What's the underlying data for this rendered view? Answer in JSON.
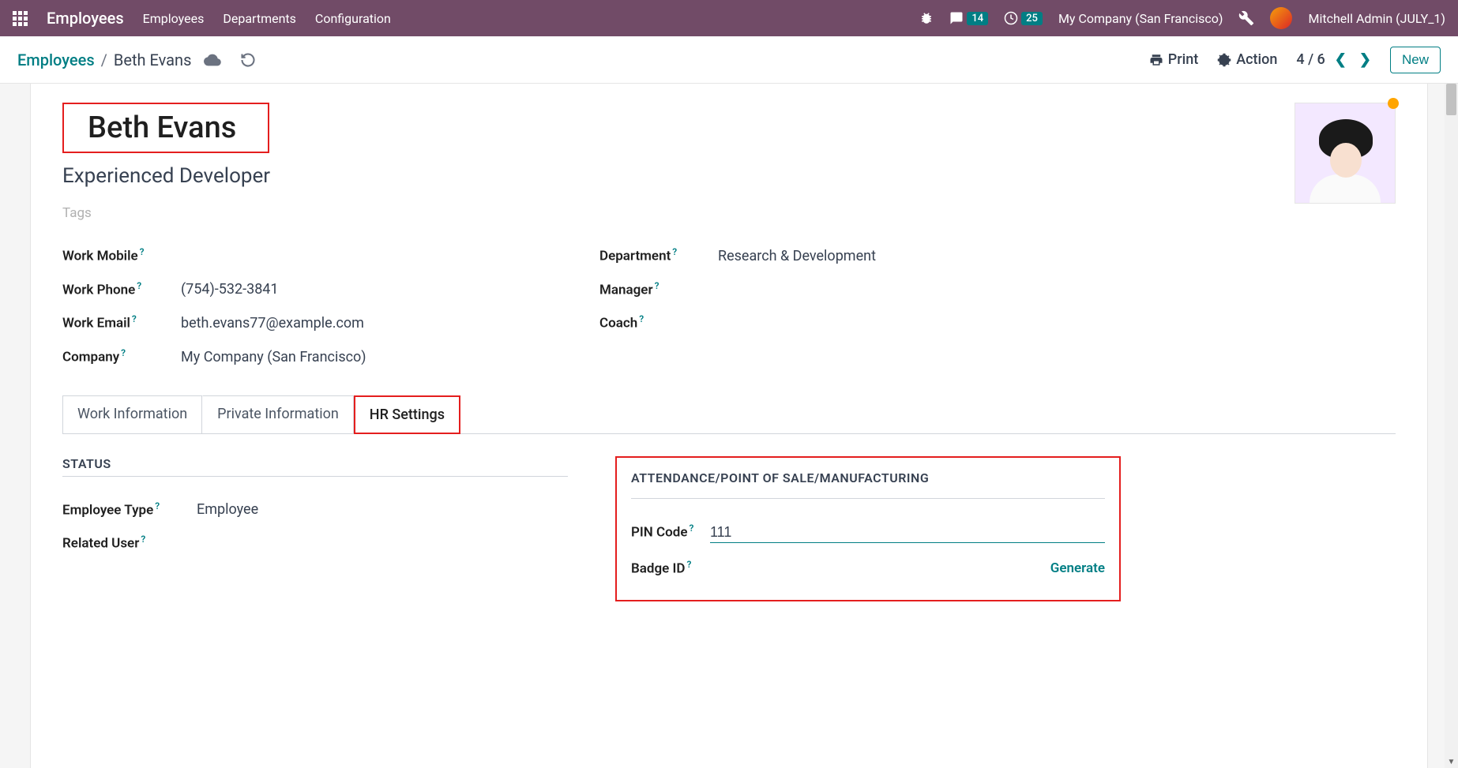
{
  "topbar": {
    "brand": "Employees",
    "nav": [
      "Employees",
      "Departments",
      "Configuration"
    ],
    "messages_count": "14",
    "activities_count": "25",
    "company": "My Company (San Francisco)",
    "user": "Mitchell Admin (JULY_1)"
  },
  "subbar": {
    "breadcrumb_root": "Employees",
    "breadcrumb_current": "Beth Evans",
    "print": "Print",
    "action": "Action",
    "pager": "4 / 6",
    "new_btn": "New"
  },
  "record": {
    "name": "Beth Evans",
    "job_title": "Experienced Developer",
    "tags_placeholder": "Tags",
    "left_fields": {
      "work_mobile_label": "Work Mobile",
      "work_mobile": "",
      "work_phone_label": "Work Phone",
      "work_phone": "(754)-532-3841",
      "work_email_label": "Work Email",
      "work_email": "beth.evans77@example.com",
      "company_label": "Company",
      "company": "My Company (San Francisco)"
    },
    "right_fields": {
      "department_label": "Department",
      "department": "Research & Development",
      "manager_label": "Manager",
      "manager": "",
      "coach_label": "Coach",
      "coach": ""
    }
  },
  "tabs": {
    "work_info": "Work Information",
    "private_info": "Private Information",
    "hr_settings": "HR Settings"
  },
  "status_panel": {
    "title": "STATUS",
    "employee_type_label": "Employee Type",
    "employee_type": "Employee",
    "related_user_label": "Related User",
    "related_user": ""
  },
  "attendance_panel": {
    "title": "ATTENDANCE/POINT OF SALE/MANUFACTURING",
    "pin_label": "PIN Code",
    "pin_value": "111",
    "badge_label": "Badge ID",
    "generate": "Generate"
  }
}
